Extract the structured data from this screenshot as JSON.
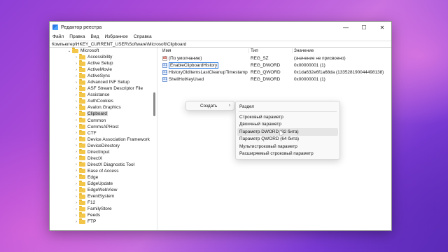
{
  "window": {
    "title": "Редактор реестра",
    "controls": {
      "minimize": "—",
      "maximize": "☐",
      "close": "✕"
    }
  },
  "menu": [
    "Файл",
    "Правка",
    "Вид",
    "Избранное",
    "Справка"
  ],
  "address": "Компьютер\\HKEY_CURRENT_USER\\Software\\Microsoft\\Clipboard",
  "tree": {
    "parent": "Microsoft",
    "items": [
      {
        "label": "Accessibility"
      },
      {
        "label": "Active Setup"
      },
      {
        "label": "ActiveMovie"
      },
      {
        "label": "ActiveSync"
      },
      {
        "label": "Advanced INF Setup"
      },
      {
        "label": "ASF Stream Descriptor File"
      },
      {
        "label": "Assistance"
      },
      {
        "label": "AuthCookies"
      },
      {
        "label": "Avalon.Graphics"
      },
      {
        "label": "Clipboard",
        "selected": true
      },
      {
        "label": "Common"
      },
      {
        "label": "CommsAPHost"
      },
      {
        "label": "CTF"
      },
      {
        "label": "Device Association Framework"
      },
      {
        "label": "DeviceDirectory"
      },
      {
        "label": "DirectInput"
      },
      {
        "label": "DirectX"
      },
      {
        "label": "DirectX Diagnostic Tool"
      },
      {
        "label": "Ease of Access"
      },
      {
        "label": "Edge"
      },
      {
        "label": "EdgeUpdate"
      },
      {
        "label": "EdgeWebView"
      },
      {
        "label": "EventSystem"
      },
      {
        "label": "F12"
      },
      {
        "label": "FamilyStore"
      },
      {
        "label": "Feeds"
      },
      {
        "label": "FTP"
      }
    ]
  },
  "values": {
    "headers": {
      "name": "Имя",
      "type": "Тип",
      "data": "Значение"
    },
    "rows": [
      {
        "icon": "string-value-icon",
        "glyph": "ab",
        "name": "(По умолчанию)",
        "type": "REG_SZ",
        "data": "(значение не присвоено)"
      },
      {
        "icon": "binary-value-icon",
        "glyph": "011",
        "name": "EnableClipboardHistory",
        "type": "REG_DWORD",
        "data": "0x00000001 (1)",
        "editing": true
      },
      {
        "icon": "binary-value-icon",
        "glyph": "011",
        "name": "HistoryOldItemsLastCleanupTimestamp",
        "type": "REG_QWORD",
        "data": "0x1da632e6f1a68da (133528190044498138)"
      },
      {
        "icon": "binary-value-icon",
        "glyph": "011",
        "name": "ShellHotKeyUsed",
        "type": "REG_DWORD",
        "data": "0x00000001 (1)"
      }
    ]
  },
  "context_menu": {
    "create_label": "Создать",
    "submenu": [
      {
        "label": "Раздел"
      },
      {
        "separator": true
      },
      {
        "label": "Строковый параметр"
      },
      {
        "label": "Двоичный параметр"
      },
      {
        "label": "Параметр DWORD (32 бита)",
        "hover": true
      },
      {
        "label": "Параметр QWORD (64 бита)"
      },
      {
        "label": "Мультистроковый параметр"
      },
      {
        "label": "Расширяемый строковый параметр"
      }
    ]
  }
}
